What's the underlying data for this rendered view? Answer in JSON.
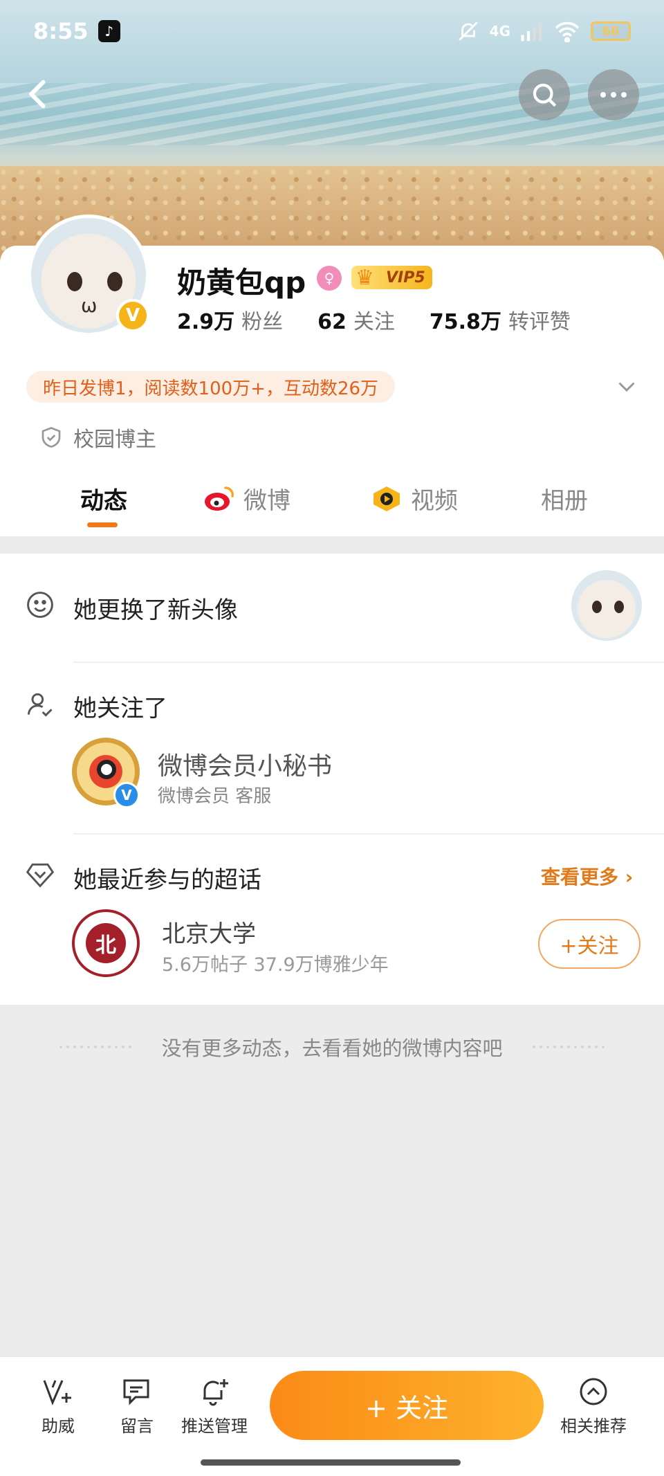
{
  "status": {
    "time": "8:55",
    "network": "4G",
    "battery": "66"
  },
  "profile": {
    "name": "奶黄包qp",
    "vip_label": "VIP5",
    "verified_mark": "V",
    "stats": [
      {
        "value": "2.9万",
        "label": "粉丝"
      },
      {
        "value": "62",
        "label": "关注"
      },
      {
        "value": "75.8万",
        "label": "转评赞"
      }
    ],
    "highlight": "昨日发博1，阅读数100万+，互动数26万",
    "tag": "校园博主"
  },
  "tabs": [
    {
      "label": "动态",
      "active": true
    },
    {
      "label": "微博",
      "active": false
    },
    {
      "label": "视频",
      "active": false
    },
    {
      "label": "相册",
      "active": false
    }
  ],
  "feed": {
    "avatar_change": "她更换了新头像",
    "followed_title": "她关注了",
    "followed_user": {
      "name": "微博会员小秘书",
      "desc": "微博会员 客服"
    },
    "topics_title": "她最近参与的超话",
    "see_more": "查看更多",
    "topic": {
      "name": "北京大学",
      "stats": "5.6万帖子 37.9万博雅少年",
      "follow": "+关注"
    }
  },
  "end_note": "没有更多动态，去看看她的微博内容吧",
  "bottom_bar": {
    "items": [
      "助威",
      "留言",
      "推送管理",
      "相关推荐"
    ],
    "follow": "+ 关注"
  },
  "colors": {
    "accent": "#f07a1a",
    "follow_gradient_start": "#fb8a16",
    "follow_gradient_end": "#fdb22d"
  }
}
